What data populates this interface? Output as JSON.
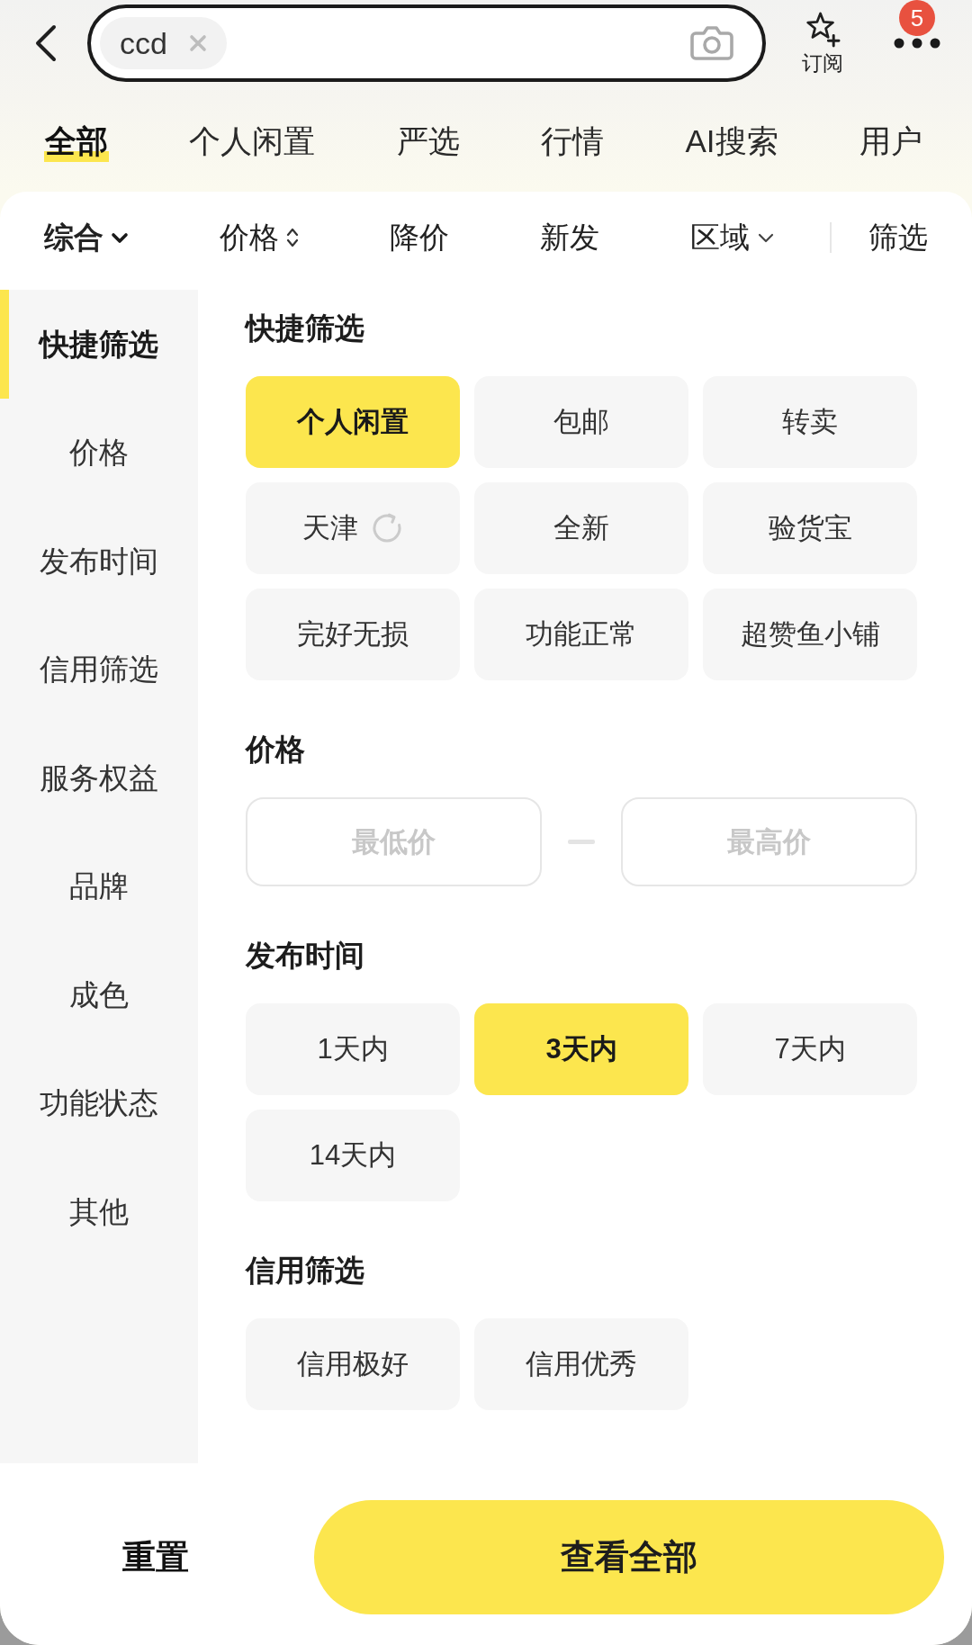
{
  "search": {
    "tags": [
      {
        "text": "ccd"
      }
    ]
  },
  "subscribe": {
    "label": "订阅"
  },
  "more": {
    "badge": "5"
  },
  "tabs": [
    {
      "label": "全部",
      "selected": true
    },
    {
      "label": "个人闲置",
      "selected": false
    },
    {
      "label": "严选",
      "selected": false
    },
    {
      "label": "行情",
      "selected": false
    },
    {
      "label": "AI搜索",
      "selected": false
    },
    {
      "label": "用户",
      "selected": false
    }
  ],
  "sort_bar": [
    {
      "label": "综合",
      "kind": "dropdown",
      "selected": true
    },
    {
      "label": "价格",
      "kind": "sort",
      "selected": false
    },
    {
      "label": "降价",
      "kind": "plain",
      "selected": false
    },
    {
      "label": "新发",
      "kind": "plain",
      "selected": false
    },
    {
      "label": "区域",
      "kind": "dropdown",
      "selected": false
    },
    {
      "label": "筛选",
      "kind": "filter",
      "selected": false
    }
  ],
  "sidebar": [
    {
      "label": "快捷筛选",
      "selected": true
    },
    {
      "label": "价格",
      "selected": false
    },
    {
      "label": "发布时间",
      "selected": false
    },
    {
      "label": "信用筛选",
      "selected": false
    },
    {
      "label": "服务权益",
      "selected": false
    },
    {
      "label": "品牌",
      "selected": false
    },
    {
      "label": "成色",
      "selected": false
    },
    {
      "label": "功能状态",
      "selected": false
    },
    {
      "label": "其他",
      "selected": false
    }
  ],
  "sections": [
    {
      "title": "快捷筛选",
      "kind": "chips",
      "options": [
        {
          "label": "个人闲置",
          "kind": "plain",
          "selected": true
        },
        {
          "label": "包邮",
          "kind": "plain",
          "selected": false
        },
        {
          "label": "转卖",
          "kind": "plain",
          "selected": false
        },
        {
          "label": "天津",
          "kind": "location",
          "selected": false
        },
        {
          "label": "全新",
          "kind": "plain",
          "selected": false
        },
        {
          "label": "验货宝",
          "kind": "plain",
          "selected": false
        },
        {
          "label": "完好无损",
          "kind": "plain",
          "selected": false
        },
        {
          "label": "功能正常",
          "kind": "plain",
          "selected": false
        },
        {
          "label": "超赞鱼小铺",
          "kind": "plain",
          "selected": false
        }
      ]
    },
    {
      "title": "价格",
      "kind": "range",
      "fields": [
        {
          "placeholder": "最低价"
        },
        {
          "placeholder": "最高价"
        }
      ]
    },
    {
      "title": "发布时间",
      "kind": "chips",
      "options": [
        {
          "label": "1天内",
          "selected": false
        },
        {
          "label": "3天内",
          "selected": true
        },
        {
          "label": "7天内",
          "selected": false
        },
        {
          "label": "14天内",
          "selected": false
        }
      ]
    },
    {
      "title": "信用筛选",
      "kind": "chips",
      "options": [
        {
          "label": "信用极好",
          "selected": false
        },
        {
          "label": "信用优秀",
          "selected": false
        }
      ]
    }
  ],
  "footer": {
    "reset": "重置",
    "submit": "查看全部"
  }
}
